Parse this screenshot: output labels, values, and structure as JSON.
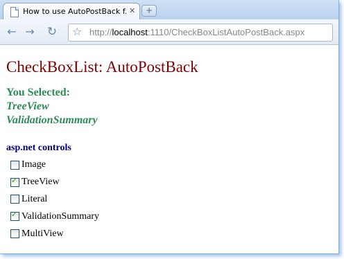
{
  "browser": {
    "tab_title": "How to use AutoPostBack f...",
    "tab_close_icon": "close-icon",
    "new_tab_icon": "new-tab-icon",
    "url_prefix": "http://",
    "url_host": "localhost",
    "url_rest": ":1110/CheckBoxListAutoPostBack.aspx"
  },
  "page": {
    "heading": "CheckBoxList: AutoPostBack",
    "selected_heading": "You Selected:",
    "selected_items": [
      "TreeView",
      "ValidationSummary"
    ],
    "controls_heading": "asp.net controls",
    "checkboxes": [
      {
        "label": "Image",
        "checked": false
      },
      {
        "label": "TreeView",
        "checked": true
      },
      {
        "label": "Literal",
        "checked": false
      },
      {
        "label": "ValidationSummary",
        "checked": true
      },
      {
        "label": "MultiView",
        "checked": false
      }
    ]
  },
  "colors": {
    "heading": "#800000",
    "selected": "#2e8b57",
    "controls_heading": "#000080",
    "checkmark": "#21a121"
  }
}
